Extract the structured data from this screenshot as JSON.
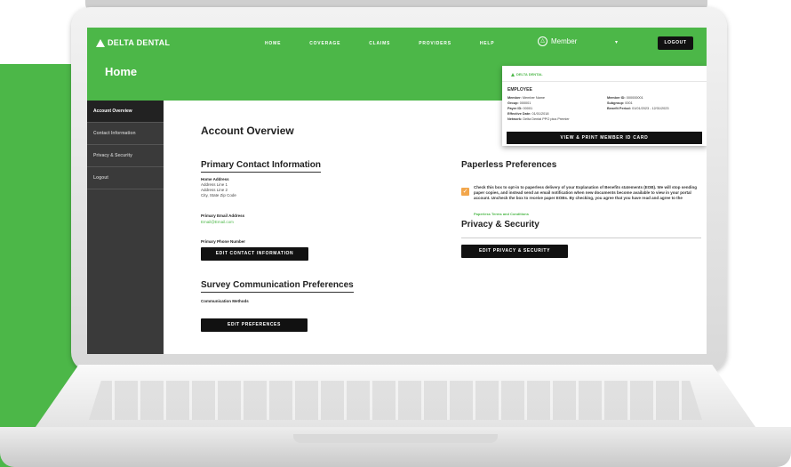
{
  "app": {
    "brand": "DELTA DENTAL",
    "nav": [
      "HOME",
      "COVERAGE",
      "CLAIMS",
      "PROVIDERS",
      "HELP"
    ],
    "member_label": "Member",
    "logout_label": "LOGOUT",
    "page_title": "Home"
  },
  "sidebar": {
    "items": [
      {
        "label": "Account Overview"
      },
      {
        "label": "Contact Information"
      },
      {
        "label": "Privacy & Security"
      },
      {
        "label": "Logout"
      }
    ]
  },
  "main": {
    "title": "Account Overview",
    "contact": {
      "heading": "Primary Contact Information",
      "address_label": "Home Address",
      "address_line1": "Address Line 1",
      "address_line2": "Address Line 2",
      "address_line3": "City, State Zip Code",
      "email_label": "Primary Email Address",
      "email_value": "Email@Email.com",
      "phone_label": "Primary Phone Number",
      "edit_button": "EDIT CONTACT INFORMATION"
    },
    "survey": {
      "heading": "Survey Communication Preferences",
      "methods_label": "Communication Methods",
      "edit_button": "EDIT PREFERENCES"
    },
    "paperless": {
      "heading": "Paperless Preferences",
      "checked": true,
      "text": "Check this box to opt-in to paperless delivery of your Explanation of Benefits statements (EOB). We will stop sending paper copies, and instead send an email notification when new documents become available to view in your portal account. Uncheck the box to receive paper EOBs. By checking, you agree that you have read and agree to the",
      "link": "Paperless Terms and Conditions"
    },
    "privacy": {
      "heading": "Privacy & Security",
      "edit_button": "EDIT PRIVACY & SECURITY"
    }
  },
  "id_card": {
    "brand": "DELTA DENTAL",
    "type": "EMPLOYEE",
    "member": {
      "label": "Member:",
      "value": "Member Name"
    },
    "member_id": {
      "label": "Member ID:",
      "value": "000000001"
    },
    "group": {
      "label": "Group:",
      "value": "000001"
    },
    "subgroup": {
      "label": "Subgroup:",
      "value": "0001"
    },
    "payer_id": {
      "label": "Payer ID:",
      "value": "00001"
    },
    "benefit_period": {
      "label": "Benefit Period:",
      "value": "01/01/2023 - 12/31/2023"
    },
    "effective_date": {
      "label": "Effective Date:",
      "value": "01/01/2018"
    },
    "network": {
      "label": "Network:",
      "value": "Delta Dental PPO plus Premier"
    },
    "button": "VIEW & PRINT MEMBER ID CARD"
  },
  "colors": {
    "brand_green": "#4cb748",
    "checkbox_orange": "#f2a64b",
    "sidebar": "#3a3a3a"
  }
}
